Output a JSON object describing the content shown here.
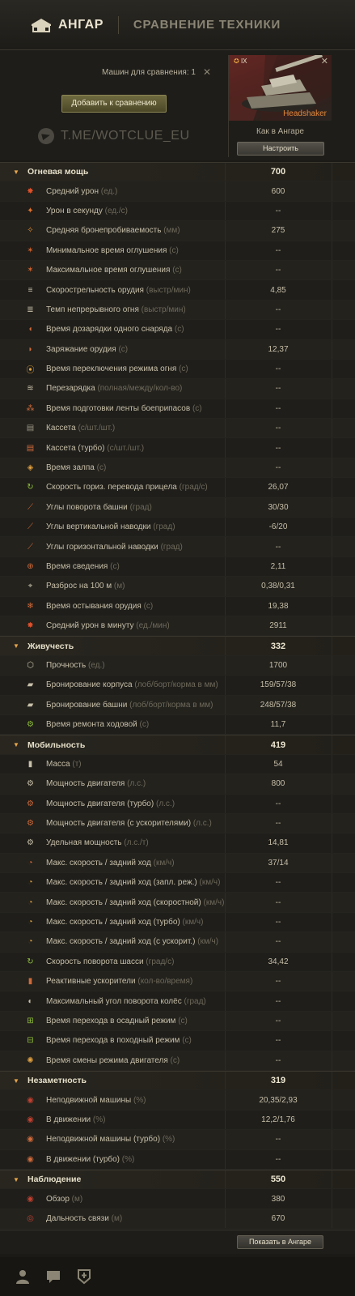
{
  "nav": {
    "hangar": "АНГАР",
    "compare": "СРАВНЕНИЕ ТЕХНИКИ"
  },
  "header": {
    "compare_count": "Машин для сравнения: 1",
    "add_button": "Добавить к сравнению",
    "watermark": "T.ME/WOTCLUE_EU"
  },
  "tank": {
    "tier": "IX",
    "name": "Headshaker",
    "state": "Как в Ангаре",
    "setup_button": "Настроить"
  },
  "rows": [
    {
      "type": "section",
      "label": "Огневая мощь",
      "value": "700"
    },
    {
      "type": "stat",
      "label": "Средний урон",
      "unit": "(ед.)",
      "value": "600",
      "icon": "damage-icon",
      "color": "#e0502a",
      "glyph": "✸"
    },
    {
      "type": "stat",
      "label": "Урон в секунду",
      "unit": "(ед./с)",
      "value": "--",
      "icon": "dps-icon",
      "color": "#e0702a",
      "glyph": "✦"
    },
    {
      "type": "stat",
      "label": "Средняя бронепробиваемость",
      "unit": "(мм)",
      "value": "275",
      "icon": "penetration-icon",
      "color": "#e08a2a",
      "glyph": "✧"
    },
    {
      "type": "stat",
      "label": "Минимальное время оглушения",
      "unit": "(с)",
      "value": "--",
      "icon": "stun-min-icon",
      "color": "#d0602a",
      "glyph": "✶"
    },
    {
      "type": "stat",
      "label": "Максимальное время оглушения",
      "unit": "(с)",
      "value": "--",
      "icon": "stun-max-icon",
      "color": "#d0602a",
      "glyph": "✶"
    },
    {
      "type": "stat",
      "label": "Скорострельность орудия",
      "unit": "(выстр/мин)",
      "value": "4,85",
      "icon": "rate-of-fire-icon",
      "color": "#c7c0aa",
      "glyph": "≡"
    },
    {
      "type": "stat",
      "label": "Темп непрерывного огня",
      "unit": "(выстр/мин)",
      "value": "--",
      "icon": "continuous-fire-icon",
      "color": "#c7c0aa",
      "glyph": "≣"
    },
    {
      "type": "stat",
      "label": "Время дозарядки одного снаряда",
      "unit": "(с)",
      "value": "--",
      "icon": "shell-reload-icon",
      "color": "#d06a3a",
      "glyph": "◖"
    },
    {
      "type": "stat",
      "label": "Заряжание орудия",
      "unit": "(с)",
      "value": "12,37",
      "icon": "reload-icon",
      "color": "#d06a3a",
      "glyph": "◗"
    },
    {
      "type": "stat",
      "label": "Время переключения режима огня",
      "unit": "(с)",
      "value": "--",
      "icon": "fire-mode-icon",
      "color": "#e0a040",
      "glyph": "⦿"
    },
    {
      "type": "stat",
      "label": "Перезарядка",
      "unit": "(полная/между/кол-во)",
      "value": "--",
      "icon": "autoreload-icon",
      "color": "#c7c0aa",
      "glyph": "≋"
    },
    {
      "type": "stat",
      "label": "Время подготовки ленты боеприпасов",
      "unit": "(с)",
      "value": "--",
      "icon": "ammo-belt-icon",
      "color": "#d06a3a",
      "glyph": "⁂"
    },
    {
      "type": "stat",
      "label": "Кассета",
      "unit": "(с/шт./шт.)",
      "value": "--",
      "icon": "magazine-icon",
      "color": "#9a9484",
      "glyph": "▤"
    },
    {
      "type": "stat",
      "label": "Кассета (турбо)",
      "unit": "(с/шт./шт.)",
      "value": "--",
      "icon": "magazine-turbo-icon",
      "color": "#d06a3a",
      "glyph": "▤"
    },
    {
      "type": "stat",
      "label": "Время залпа",
      "unit": "(с)",
      "value": "--",
      "icon": "salvo-icon",
      "color": "#e0a040",
      "glyph": "◈"
    },
    {
      "type": "stat",
      "label": "Скорость гориз. перевода прицела",
      "unit": "(град/с)",
      "value": "26,07",
      "icon": "traverse-speed-icon",
      "color": "#8fbf3a",
      "glyph": "↻"
    },
    {
      "type": "stat",
      "label": "Углы поворота башни",
      "unit": "(град)",
      "value": "30/30",
      "icon": "turret-angle-icon",
      "color": "#d06a3a",
      "glyph": "⟋"
    },
    {
      "type": "stat",
      "label": "Углы вертикальной наводки",
      "unit": "(град)",
      "value": "-6/20",
      "icon": "elevation-icon",
      "color": "#d06a3a",
      "glyph": "⟋"
    },
    {
      "type": "stat",
      "label": "Углы горизонтальной наводки",
      "unit": "(град)",
      "value": "--",
      "icon": "horizontal-aim-icon",
      "color": "#d06a3a",
      "glyph": "⟋"
    },
    {
      "type": "stat",
      "label": "Время сведения",
      "unit": "(с)",
      "value": "2,11",
      "icon": "aim-time-icon",
      "color": "#d06a3a",
      "glyph": "⊕"
    },
    {
      "type": "stat",
      "label": "Разброс на 100 м",
      "unit": "(м)",
      "value": "0,38/0,31",
      "icon": "dispersion-icon",
      "color": "#c7c0aa",
      "glyph": "⌖"
    },
    {
      "type": "stat",
      "label": "Время остывания орудия",
      "unit": "(с)",
      "value": "19,38",
      "icon": "cooldown-icon",
      "color": "#d06a3a",
      "glyph": "❄"
    },
    {
      "type": "stat",
      "label": "Средний урон в минуту",
      "unit": "(ед./мин)",
      "value": "2911",
      "icon": "damage-per-minute-icon",
      "color": "#e0502a",
      "glyph": "✸"
    },
    {
      "type": "section",
      "label": "Живучесть",
      "value": "332"
    },
    {
      "type": "stat",
      "label": "Прочность",
      "unit": "(ед.)",
      "value": "1700",
      "icon": "hitpoints-icon",
      "color": "#c7c0aa",
      "glyph": "⬡"
    },
    {
      "type": "stat",
      "label": "Бронирование корпуса",
      "unit": "(лоб/борт/корма в мм)",
      "value": "159/57/38",
      "icon": "hull-armor-icon",
      "color": "#c7c0aa",
      "glyph": "▰"
    },
    {
      "type": "stat",
      "label": "Бронирование башни",
      "unit": "(лоб/борт/корма в мм)",
      "value": "248/57/38",
      "icon": "turret-armor-icon",
      "color": "#c7c0aa",
      "glyph": "▰"
    },
    {
      "type": "stat",
      "label": "Время ремонта ходовой",
      "unit": "(с)",
      "value": "11,7",
      "icon": "track-repair-icon",
      "color": "#8fbf3a",
      "glyph": "⚙"
    },
    {
      "type": "section",
      "label": "Мобильность",
      "value": "419"
    },
    {
      "type": "stat",
      "label": "Масса",
      "unit": "(т)",
      "value": "54",
      "icon": "weight-icon",
      "color": "#c7c0aa",
      "glyph": "▮"
    },
    {
      "type": "stat",
      "label": "Мощность двигателя",
      "unit": "(л.с.)",
      "value": "800",
      "icon": "engine-power-icon",
      "color": "#c7c0aa",
      "glyph": "⚙"
    },
    {
      "type": "stat",
      "label": "Мощность двигателя (турбо)",
      "unit": "(л.с.)",
      "value": "--",
      "icon": "engine-turbo-icon",
      "color": "#d06a3a",
      "glyph": "⚙"
    },
    {
      "type": "stat",
      "label": "Мощность двигателя (с ускорителями)",
      "unit": "(л.с.)",
      "value": "--",
      "icon": "engine-boost-icon",
      "color": "#d06a3a",
      "glyph": "⚙"
    },
    {
      "type": "stat",
      "label": "Удельная мощность",
      "unit": "(л.с./т)",
      "value": "14,81",
      "icon": "specific-power-icon",
      "color": "#c7c0aa",
      "glyph": "⚙"
    },
    {
      "type": "stat",
      "label": "Макс. скорость / задний ход",
      "unit": "(км/ч)",
      "value": "37/14",
      "icon": "speed-icon",
      "color": "#d06a3a",
      "glyph": "◔"
    },
    {
      "type": "stat",
      "label": "Макс. скорость / задний ход (запл. реж.)",
      "unit": "(км/ч)",
      "value": "--",
      "icon": "speed-siege-icon",
      "color": "#e0a040",
      "glyph": "◔"
    },
    {
      "type": "stat",
      "label": "Макс. скорость / задний ход (скоростной)",
      "unit": "(км/ч)",
      "value": "--",
      "icon": "speed-fast-icon",
      "color": "#e0a040",
      "glyph": "◔"
    },
    {
      "type": "stat",
      "label": "Макс. скорость / задний ход (турбо)",
      "unit": "(км/ч)",
      "value": "--",
      "icon": "speed-turbo-icon",
      "color": "#e0a040",
      "glyph": "◔"
    },
    {
      "type": "stat",
      "label": "Макс. скорость / задний ход (с ускорит.)",
      "unit": "(км/ч)",
      "value": "--",
      "icon": "speed-boost-icon",
      "color": "#e0a040",
      "glyph": "◔"
    },
    {
      "type": "stat",
      "label": "Скорость поворота шасси",
      "unit": "(град/с)",
      "value": "34,42",
      "icon": "hull-traverse-icon",
      "color": "#8fbf3a",
      "glyph": "↻"
    },
    {
      "type": "stat",
      "label": "Реактивные ускорители",
      "unit": "(кол-во/время)",
      "value": "--",
      "icon": "rocket-boosters-icon",
      "color": "#d06a3a",
      "glyph": "▮"
    },
    {
      "type": "stat",
      "label": "Максимальный угол поворота колёс",
      "unit": "(град)",
      "value": "--",
      "icon": "wheel-angle-icon",
      "color": "#c7c0aa",
      "glyph": "◐"
    },
    {
      "type": "stat",
      "label": "Время перехода в осадный режим",
      "unit": "(с)",
      "value": "--",
      "icon": "siege-mode-icon",
      "color": "#8fbf3a",
      "glyph": "⊞"
    },
    {
      "type": "stat",
      "label": "Время перехода в походный режим",
      "unit": "(с)",
      "value": "--",
      "icon": "travel-mode-icon",
      "color": "#8fbf3a",
      "glyph": "⊟"
    },
    {
      "type": "stat",
      "label": "Время смены режима двигателя",
      "unit": "(с)",
      "value": "--",
      "icon": "engine-mode-icon",
      "color": "#e0a040",
      "glyph": "✺"
    },
    {
      "type": "section",
      "label": "Незаметность",
      "value": "319"
    },
    {
      "type": "stat",
      "label": "Неподвижной машины",
      "unit": "(%)",
      "value": "20,35/2,93",
      "icon": "camo-stationary-icon",
      "color": "#c04030",
      "glyph": "◉"
    },
    {
      "type": "stat",
      "label": "В движении",
      "unit": "(%)",
      "value": "12,2/1,76",
      "icon": "camo-moving-icon",
      "color": "#c04030",
      "glyph": "◉"
    },
    {
      "type": "stat",
      "label": "Неподвижной машины (турбо)",
      "unit": "(%)",
      "value": "--",
      "icon": "camo-stationary-turbo-icon",
      "color": "#d06a3a",
      "glyph": "◉"
    },
    {
      "type": "stat",
      "label": "В движении (турбо)",
      "unit": "(%)",
      "value": "--",
      "icon": "camo-moving-turbo-icon",
      "color": "#d06a3a",
      "glyph": "◉"
    },
    {
      "type": "section",
      "label": "Наблюдение",
      "value": "550"
    },
    {
      "type": "stat",
      "label": "Обзор",
      "unit": "(м)",
      "value": "380",
      "icon": "view-range-icon",
      "color": "#c04030",
      "glyph": "◉"
    },
    {
      "type": "stat",
      "label": "Дальность связи",
      "unit": "(м)",
      "value": "670",
      "icon": "radio-range-icon",
      "color": "#c04030",
      "glyph": "◎"
    }
  ],
  "footer": {
    "show_button": "Показать в Ангаре"
  },
  "bottom_bar": [
    "profile-icon",
    "chat-icon",
    "clan-icon"
  ]
}
